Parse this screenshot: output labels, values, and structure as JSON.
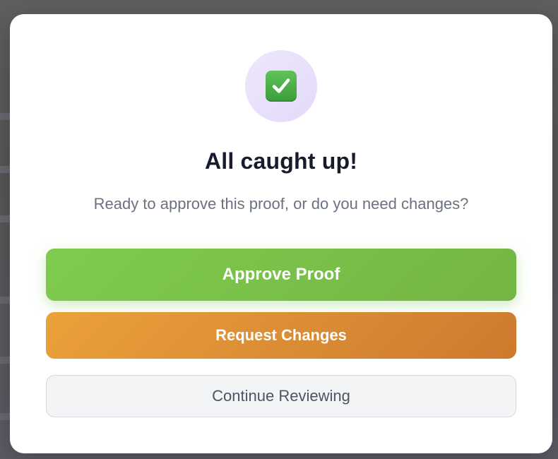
{
  "dialog": {
    "icon": "check-mark-button-icon",
    "title": "All caught up!",
    "message": "Ready to approve this proof, or do you need changes?",
    "buttons": {
      "approve_label": "Approve Proof",
      "request_changes_label": "Request Changes",
      "continue_label": "Continue Reviewing"
    }
  },
  "colors": {
    "approve": "#7fcb4f",
    "request_changes": "#e0913a",
    "continue_bg": "#f3f4f6",
    "icon_circle": "#ebe4fb",
    "title": "#181b2c",
    "message": "#6b7280"
  }
}
